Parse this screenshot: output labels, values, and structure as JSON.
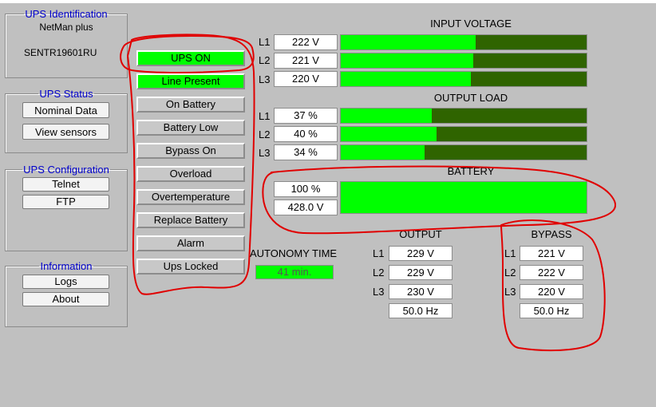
{
  "ups_identification": {
    "legend": "UPS Identification",
    "model": "NetMan plus",
    "serial": "SENTR19601RU"
  },
  "ups_status": {
    "legend": "UPS Status",
    "nominal_data": "Nominal Data",
    "view_sensors": "View sensors"
  },
  "ups_configuration": {
    "legend": "UPS Configuration",
    "telnet": "Telnet",
    "ftp": "FTP"
  },
  "information": {
    "legend": "Information",
    "logs": "Logs",
    "about": "About"
  },
  "indicators": [
    {
      "label": "UPS ON",
      "active": true
    },
    {
      "label": "Line Present",
      "active": true
    },
    {
      "label": "On Battery",
      "active": false
    },
    {
      "label": "Battery Low",
      "active": false
    },
    {
      "label": "Bypass On",
      "active": false
    },
    {
      "label": "Overload",
      "active": false
    },
    {
      "label": "Overtemperature",
      "active": false
    },
    {
      "label": "Replace Battery",
      "active": false
    },
    {
      "label": "Alarm",
      "active": false
    },
    {
      "label": "Ups Locked",
      "active": false
    }
  ],
  "input_voltage": {
    "title": "INPUT VOLTAGE",
    "phases": [
      {
        "label": "L1",
        "value": "222 V",
        "level": 0.55
      },
      {
        "label": "L2",
        "value": "221 V",
        "level": 0.54
      },
      {
        "label": "L3",
        "value": "220 V",
        "level": 0.53
      }
    ]
  },
  "output_load": {
    "title": "OUTPUT LOAD",
    "phases": [
      {
        "label": "L1",
        "value": "37 %",
        "level": 0.37
      },
      {
        "label": "L2",
        "value": "40 %",
        "level": 0.39
      },
      {
        "label": "L3",
        "value": "34 %",
        "level": 0.34
      }
    ]
  },
  "battery": {
    "title": "BATTERY",
    "charge": "100 %",
    "voltage": "428.0 V",
    "level": 1.0
  },
  "autonomy": {
    "title": "AUTONOMY TIME",
    "value": "41 min."
  },
  "output": {
    "title": "OUTPUT",
    "phases": [
      {
        "label": "L1",
        "value": "229 V"
      },
      {
        "label": "L2",
        "value": "229 V"
      },
      {
        "label": "L3",
        "value": "230 V"
      }
    ],
    "frequency": "50.0 Hz"
  },
  "bypass": {
    "title": "BYPASS",
    "phases": [
      {
        "label": "L1",
        "value": "221 V"
      },
      {
        "label": "L2",
        "value": "222 V"
      },
      {
        "label": "L3",
        "value": "220 V"
      }
    ],
    "frequency": "50.0 Hz"
  },
  "colors": {
    "active": "#00ff00",
    "bar_background": "#2f6400",
    "annotation": "#e00000",
    "legend": "#0000cc"
  }
}
